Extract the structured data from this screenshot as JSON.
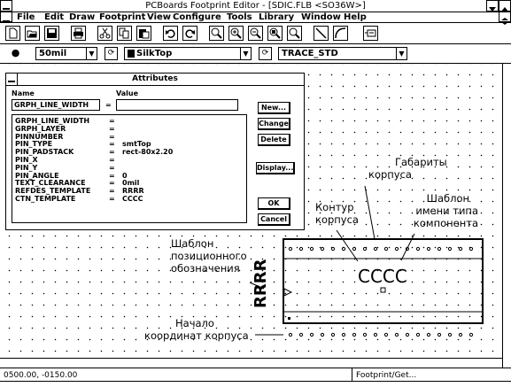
{
  "window": {
    "title": "PCBoards Footprint Editor - [SDIC.FLB <SO36W>]"
  },
  "menu": [
    {
      "label": "File"
    },
    {
      "label": "Edit"
    },
    {
      "label": "Draw"
    },
    {
      "label": "Footprint"
    },
    {
      "label": "View"
    },
    {
      "label": "Configure"
    },
    {
      "label": "Tools"
    },
    {
      "label": "Library"
    },
    {
      "label": "Window"
    },
    {
      "label": "Help"
    }
  ],
  "toolbar": {
    "buttons": [
      "new-icon",
      "open-icon",
      "save-icon",
      "print-icon",
      "cut-icon",
      "copy-icon",
      "paste-icon",
      "undo-icon",
      "redo-icon",
      "zoom-fit-icon",
      "zoom-in-icon",
      "zoom-out-icon",
      "zoom-window-icon",
      "zoom-last-icon",
      "line-icon",
      "arc-icon",
      "refdes-icon"
    ]
  },
  "toolbar2": {
    "grid_value": "50mil",
    "layer": "SilkTop",
    "trace_style": "TRACE_STD",
    "layer_color": "#000000"
  },
  "dialog": {
    "title": "Attributes",
    "name_label": "Name",
    "value_label": "Value",
    "name_field": "GRPH_LINE_WIDTH",
    "equals": "=",
    "value_field": "",
    "rows": [
      {
        "name": "GRPH_LINE_WIDTH",
        "value": ""
      },
      {
        "name": "GRPH_LAYER",
        "value": ""
      },
      {
        "name": "PINNUMBER",
        "value": ""
      },
      {
        "name": "PIN_TYPE",
        "value": "smtTop"
      },
      {
        "name": "PIN_PADSTACK",
        "value": "rect-80x2.20"
      },
      {
        "name": "PIN_X",
        "value": ""
      },
      {
        "name": "PIN_Y",
        "value": ""
      },
      {
        "name": "PIN_ANGLE",
        "value": "0"
      },
      {
        "name": "TEXT_CLEARANCE",
        "value": "0mil"
      },
      {
        "name": "REFDES_TEMPLATE",
        "value": "RRRR"
      },
      {
        "name": "CTN_TEMPLATE",
        "value": "CCCC"
      }
    ],
    "buttons": {
      "new": "New...",
      "change": "Change",
      "delete": "Delete",
      "display": "Display...",
      "ok": "OK",
      "cancel": "Cancel"
    }
  },
  "footprint": {
    "refdes": "RRRR",
    "ctn": "CCCC"
  },
  "annotations": {
    "gabarity": [
      "Габариты",
      "корпуса"
    ],
    "kontur": [
      "Контур",
      "корпуса"
    ],
    "shablon_tipa": [
      "Шаблон",
      "имени типа",
      "компонента"
    ],
    "shablon_pozicion": [
      "Шаблон",
      "позиционного",
      "обозначения"
    ],
    "nachalo": [
      "Начало",
      "координат корпуса"
    ]
  },
  "status": {
    "coords": "0500.00, -0150.00",
    "message": "Footprint/Get..."
  }
}
